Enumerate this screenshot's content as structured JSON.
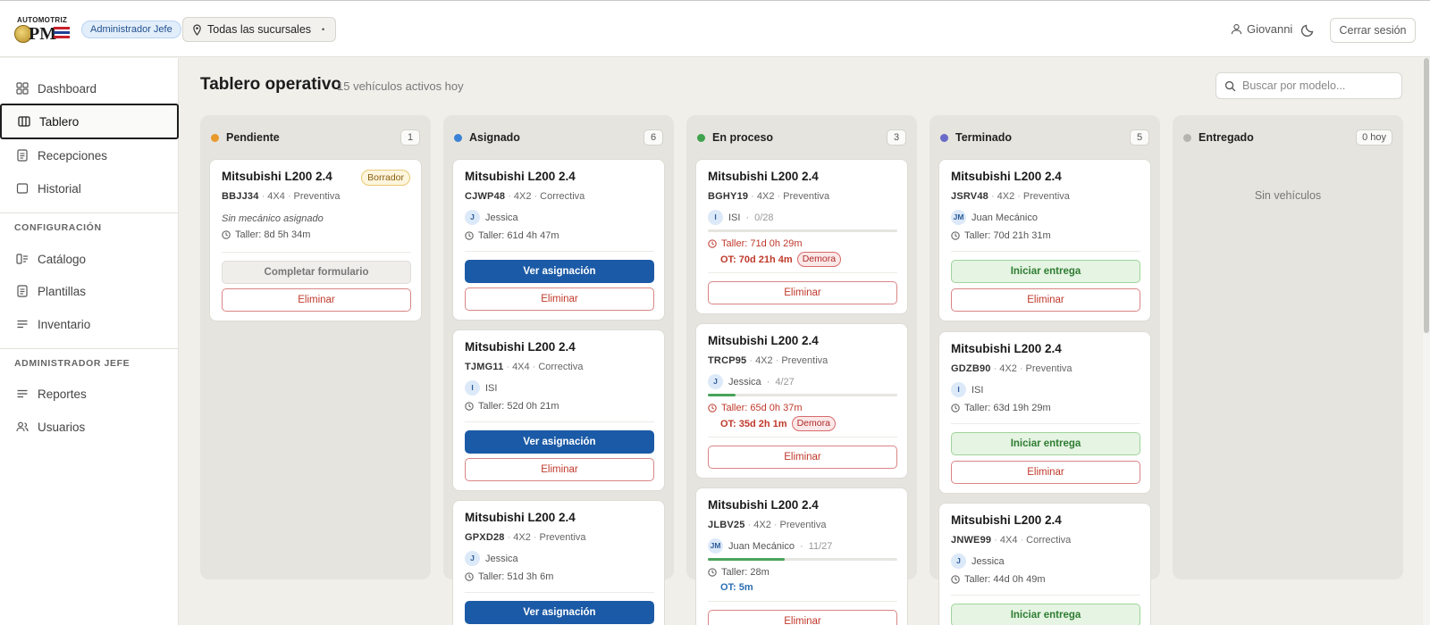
{
  "header": {
    "logo_text_top": "AUTOMOTRIZ",
    "logo_text_main": "PM",
    "role_badge": "Administrador Jefe",
    "branch_select": "Todas las sucursales",
    "user_name": "Giovanni",
    "logout_label": "Cerrar sesión"
  },
  "sidebar": {
    "items": [
      {
        "label": "Dashboard",
        "icon": "grid-icon"
      },
      {
        "label": "Tablero",
        "icon": "columns-icon"
      },
      {
        "label": "Recepciones",
        "icon": "document-icon"
      },
      {
        "label": "Historial",
        "icon": "square-icon"
      }
    ],
    "config_title": "CONFIGURACIÓN",
    "config_items": [
      {
        "label": "Catálogo",
        "icon": "catalog-icon"
      },
      {
        "label": "Plantillas",
        "icon": "document-icon"
      },
      {
        "label": "Inventario",
        "icon": "list-icon"
      }
    ],
    "admin_title": "ADMINISTRADOR JEFE",
    "admin_items": [
      {
        "label": "Reportes",
        "icon": "list-icon"
      },
      {
        "label": "Usuarios",
        "icon": "users-icon"
      }
    ]
  },
  "main": {
    "title": "Tablero operativo",
    "subtitle": "15 vehículos activos hoy",
    "search_placeholder": "Buscar por modelo..."
  },
  "colors": {
    "pending": "#e89a2c",
    "assigned": "#3b82d6",
    "in_process": "#3fa34d",
    "finished": "#6a6ac8",
    "delivered": "#b5b5b0",
    "primary": "#1b5aa6",
    "danger": "#c0392b"
  },
  "columns": [
    {
      "name": "Pendiente",
      "count": "1",
      "cards": [
        {
          "model": "Mitsubishi L200 2.4",
          "plate": "BBJJ34",
          "traction": "4X4",
          "type": "Preventiva",
          "badge": "Borrador",
          "mechanic_none": "Sin mecánico asignado",
          "taller": "Taller: 8d 5h 34m",
          "btn1": "Completar formulario",
          "btn2": "Eliminar"
        }
      ]
    },
    {
      "name": "Asignado",
      "count": "6",
      "cards": [
        {
          "model": "Mitsubishi L200 2.4",
          "plate": "CJWP48",
          "traction": "4X2",
          "type": "Correctiva",
          "avatar": "J",
          "mechanic": "Jessica",
          "taller": "Taller: 61d 4h 47m",
          "btn1": "Ver asignación",
          "btn2": "Eliminar"
        },
        {
          "model": "Mitsubishi L200 2.4",
          "plate": "TJMG11",
          "traction": "4X4",
          "type": "Correctiva",
          "avatar": "I",
          "mechanic": "ISI",
          "taller": "Taller: 52d 0h 21m",
          "btn1": "Ver asignación",
          "btn2": "Eliminar"
        },
        {
          "model": "Mitsubishi L200 2.4",
          "plate": "GPXD28",
          "traction": "4X2",
          "type": "Preventiva",
          "avatar": "J",
          "mechanic": "Jessica",
          "taller": "Taller: 51d 3h 6m",
          "btn1": "Ver asignación"
        }
      ]
    },
    {
      "name": "En proceso",
      "count": "3",
      "cards": [
        {
          "model": "Mitsubishi L200 2.4",
          "plate": "BGHY19",
          "traction": "4X2",
          "type": "Preventiva",
          "avatar": "I",
          "mechanic": "ISI",
          "tasks": "0/28",
          "progress": 0,
          "taller": "Taller: 71d 0h 29m",
          "ot": "OT: 70d 21h 4m",
          "delay": "Demora",
          "btn2": "Eliminar"
        },
        {
          "model": "Mitsubishi L200 2.4",
          "plate": "TRCP95",
          "traction": "4X2",
          "type": "Preventiva",
          "avatar": "J",
          "mechanic": "Jessica",
          "tasks": "4/27",
          "progress": 0.148,
          "taller": "Taller: 65d 0h 37m",
          "ot": "OT: 35d 2h 1m",
          "delay": "Demora",
          "btn2": "Eliminar"
        },
        {
          "model": "Mitsubishi L200 2.4",
          "plate": "JLBV25",
          "traction": "4X2",
          "type": "Preventiva",
          "avatar": "JM",
          "mechanic": "Juan Mecánico",
          "tasks": "11/27",
          "progress": 0.407,
          "taller": "Taller: 28m",
          "ot": "OT: 5m",
          "btn2": "Eliminar"
        }
      ]
    },
    {
      "name": "Terminado",
      "count": "5",
      "cards": [
        {
          "model": "Mitsubishi L200 2.4",
          "plate": "JSRV48",
          "traction": "4X2",
          "type": "Preventiva",
          "avatar": "JM",
          "mechanic": "Juan Mecánico",
          "taller": "Taller: 70d 21h 31m",
          "btn1": "Iniciar entrega",
          "btn2": "Eliminar"
        },
        {
          "model": "Mitsubishi L200 2.4",
          "plate": "GDZB90",
          "traction": "4X2",
          "type": "Preventiva",
          "avatar": "I",
          "mechanic": "ISI",
          "taller": "Taller: 63d 19h 29m",
          "btn1": "Iniciar entrega",
          "btn2": "Eliminar"
        },
        {
          "model": "Mitsubishi L200 2.4",
          "plate": "JNWE99",
          "traction": "4X4",
          "type": "Correctiva",
          "avatar": "J",
          "mechanic": "Jessica",
          "taller": "Taller: 44d 0h 49m",
          "btn1": "Iniciar entrega"
        }
      ]
    },
    {
      "name": "Entregado",
      "count": "0 hoy",
      "empty": "Sin vehículos",
      "cards": []
    }
  ]
}
